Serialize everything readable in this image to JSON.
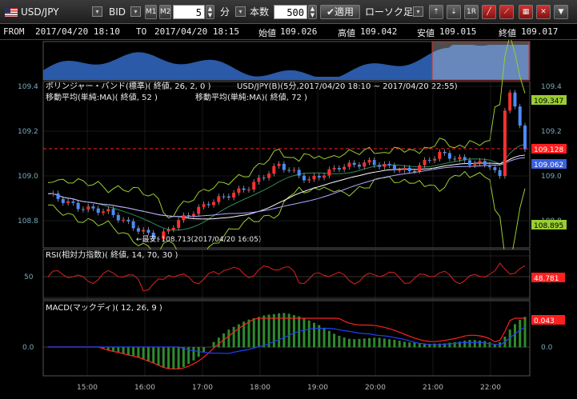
{
  "toolbar": {
    "symbol": "USD/JPY",
    "price_type": "BID",
    "m1": "M1",
    "m2": "M2",
    "interval_value": "5",
    "interval_unit": "分",
    "count_label": "本数",
    "count_value": "500",
    "apply_label": "適用",
    "chart_type": "ローソク足",
    "icons": [
      "zoom-in-icon",
      "zoom-out-icon",
      "reset-1r-icon",
      "draw-line-icon",
      "draw-trend-icon",
      "indicator-icon",
      "close-x-icon",
      "menu-down-icon"
    ],
    "one_r": "1R"
  },
  "info": {
    "from_label": "FROM",
    "from_value": "2017/04/20 18:10",
    "to_label": "TO",
    "to_value": "2017/04/20 18:15",
    "open_label": "始値",
    "open_value": "109.026",
    "high_label": "高値",
    "high_value": "109.042",
    "low_label": "安値",
    "low_value": "109.015",
    "close_label": "終値",
    "close_value": "109.017"
  },
  "main": {
    "legend1": "ボリンジャー・バンド(標準)( 終値, 26, 2, 0 )",
    "legend1_symbol": "USD/JPY(B)(5分,2017/04/20 18:10 ~ 2017/04/20 22:55)",
    "legend2a": "移動平均(単純:MA)( 終値, 52 )",
    "legend2b": "移動平均(単純:MA)( 終値, 72 )",
    "low_note": "←最安: 108.713(2017/04/20 16:05)",
    "y_ticks": [
      "109.4",
      "109.2",
      "109.0",
      "108.8"
    ],
    "tags": [
      {
        "text": "109.347",
        "bg": "#9acd32"
      },
      {
        "text": "109.128",
        "bg": "#ff1f1f"
      },
      {
        "text": "109.062",
        "bg": "#3a5fe0"
      },
      {
        "text": "108.895",
        "bg": "#9acd32"
      }
    ]
  },
  "rsi": {
    "legend": "RSI(相対力指数)( 終値, 14, 70, 30 )",
    "y_tick": "50",
    "tag": "48.781"
  },
  "macd": {
    "legend": "MACD(マックディ)( 12, 26, 9 )",
    "y_tick": "0.0",
    "y_tick_right": "0.0",
    "tag": "0.043"
  },
  "x_ticks": [
    "15:00",
    "16:00",
    "17:00",
    "18:00",
    "19:00",
    "20:00",
    "21:00",
    "22:00"
  ],
  "colors": {
    "candle_up": "#ff3030",
    "candle_down": "#4a8cff",
    "bb_upper": "#9acd32",
    "bb_mid": "#2e8b57",
    "ma52": "#ffffff",
    "ma72": "#b0a8ff",
    "rsi_line": "#e02020",
    "macd_line": "#ff2020",
    "signal_line": "#2040ff",
    "hist": "#2e8b2e",
    "overview": "#2a5aa8"
  }
}
